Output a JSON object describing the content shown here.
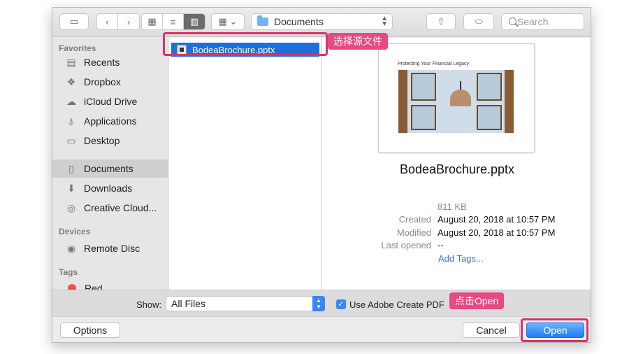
{
  "toolbar": {
    "location": "Documents",
    "search_placeholder": "Search"
  },
  "sidebar": {
    "favorites_title": "Favorites",
    "favorites": [
      {
        "label": "Recents",
        "icon": "recents-icon"
      },
      {
        "label": "Dropbox",
        "icon": "dropbox-icon"
      },
      {
        "label": "iCloud Drive",
        "icon": "cloud-icon"
      },
      {
        "label": "Applications",
        "icon": "applications-icon"
      },
      {
        "label": "Desktop",
        "icon": "desktop-icon"
      },
      {
        "label": "Documents",
        "icon": "documents-icon",
        "selected": true
      },
      {
        "label": "Downloads",
        "icon": "downloads-icon"
      },
      {
        "label": "Creative Cloud...",
        "icon": "creative-cloud-icon"
      }
    ],
    "devices_title": "Devices",
    "devices": [
      {
        "label": "Remote Disc",
        "icon": "disc-icon"
      }
    ],
    "tags_title": "Tags",
    "tags": [
      {
        "label": "Red",
        "color": "#f0504b"
      }
    ]
  },
  "file_list": {
    "selected_file": "BodeaBrochure.pptx"
  },
  "preview": {
    "thumb_title": "Protecting Your Financial Legacy",
    "filename": "BodeaBrochure.pptx",
    "size": "811 KB",
    "created_label": "Created",
    "created_value": "August 20, 2018 at 10:57 PM",
    "modified_label": "Modified",
    "modified_value": "August 20, 2018 at 10:57 PM",
    "last_opened_label": "Last opened",
    "last_opened_value": "--",
    "add_tags": "Add Tags..."
  },
  "show_bar": {
    "label": "Show:",
    "selected": "All Files",
    "checkbox_label": "Use Adobe Create PDF",
    "checkbox_checked": true
  },
  "buttons": {
    "options": "Options",
    "cancel": "Cancel",
    "open": "Open"
  },
  "annotations": {
    "select_source": "选择源文件",
    "click_open": "点击Open"
  },
  "colors": {
    "accent": "#1e6fd9",
    "annotation": "#e64984"
  }
}
